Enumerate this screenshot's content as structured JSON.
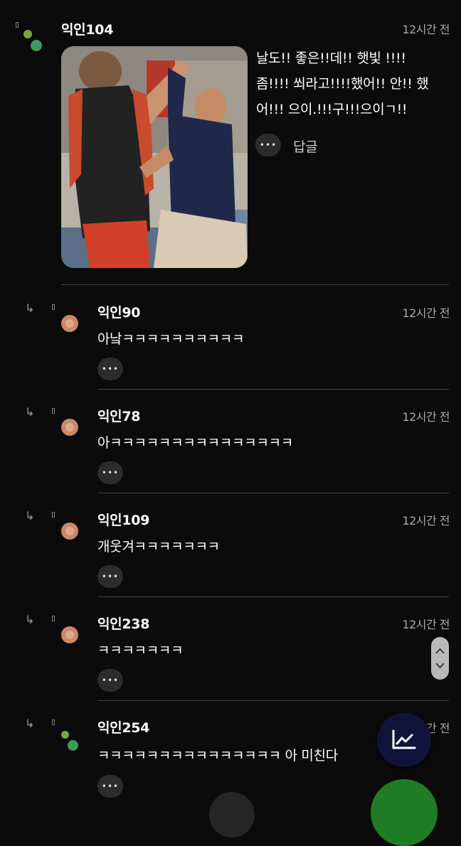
{
  "colors": {
    "background": "#0b0b0b",
    "fab_chart": "#12133a",
    "fab_green": "#1e7d24",
    "avatar": "#c98a6a",
    "dot_olive": "#7aa83e",
    "dot_green": "#3e9a5b"
  },
  "main_comment": {
    "author": "익인104",
    "time": "12시간 전",
    "text_lines": [
      "날도!! 좋은!!데!! 햇빛 !!!!",
      "좀!!!! 쐬라고!!!!했어!! 안!! 했",
      "어!!! 으이.!!!구!!!으이ㄱ!!"
    ],
    "more_label": "•••",
    "reply_label": "답글",
    "photo_alt": "volleyball-players-photo"
  },
  "replies": [
    {
      "author": "익인90",
      "time": "12시간 전",
      "text": "아낰ㅋㅋㅋㅋㅋㅋㅋㅋㅋㅋ",
      "more_label": "•••",
      "avatar": "peach-avatar"
    },
    {
      "author": "익인78",
      "time": "12시간 전",
      "text": "아ㅋㅋㅋㅋㅋㅋㅋㅋㅋㅋㅋㅋㅋㅋㅋ",
      "more_label": "•••",
      "avatar": "peach-avatar"
    },
    {
      "author": "익인109",
      "time": "12시간 전",
      "text": "개웃겨ㅋㅋㅋㅋㅋㅋㅋ",
      "more_label": "•••",
      "avatar": "peach-avatar"
    },
    {
      "author": "익인238",
      "time": "12시간 전",
      "text": "ㅋㅋㅋㅋㅋㅋㅋ",
      "more_label": "•••",
      "avatar": "peach-avatar"
    },
    {
      "author": "익인254",
      "time": "12시간 전",
      "text": "ㅋㅋㅋㅋㅋㅋㅋㅋㅋㅋㅋㅋㅋㅋㅋ 아 미친다",
      "more_label": "•••",
      "avatar": "green-dots-avatar"
    }
  ],
  "icons": {
    "reply_arrow": "reply-arrow-icon",
    "scroll": "scroll-up-down-icon",
    "chart_fab": "trending-chart-icon"
  }
}
